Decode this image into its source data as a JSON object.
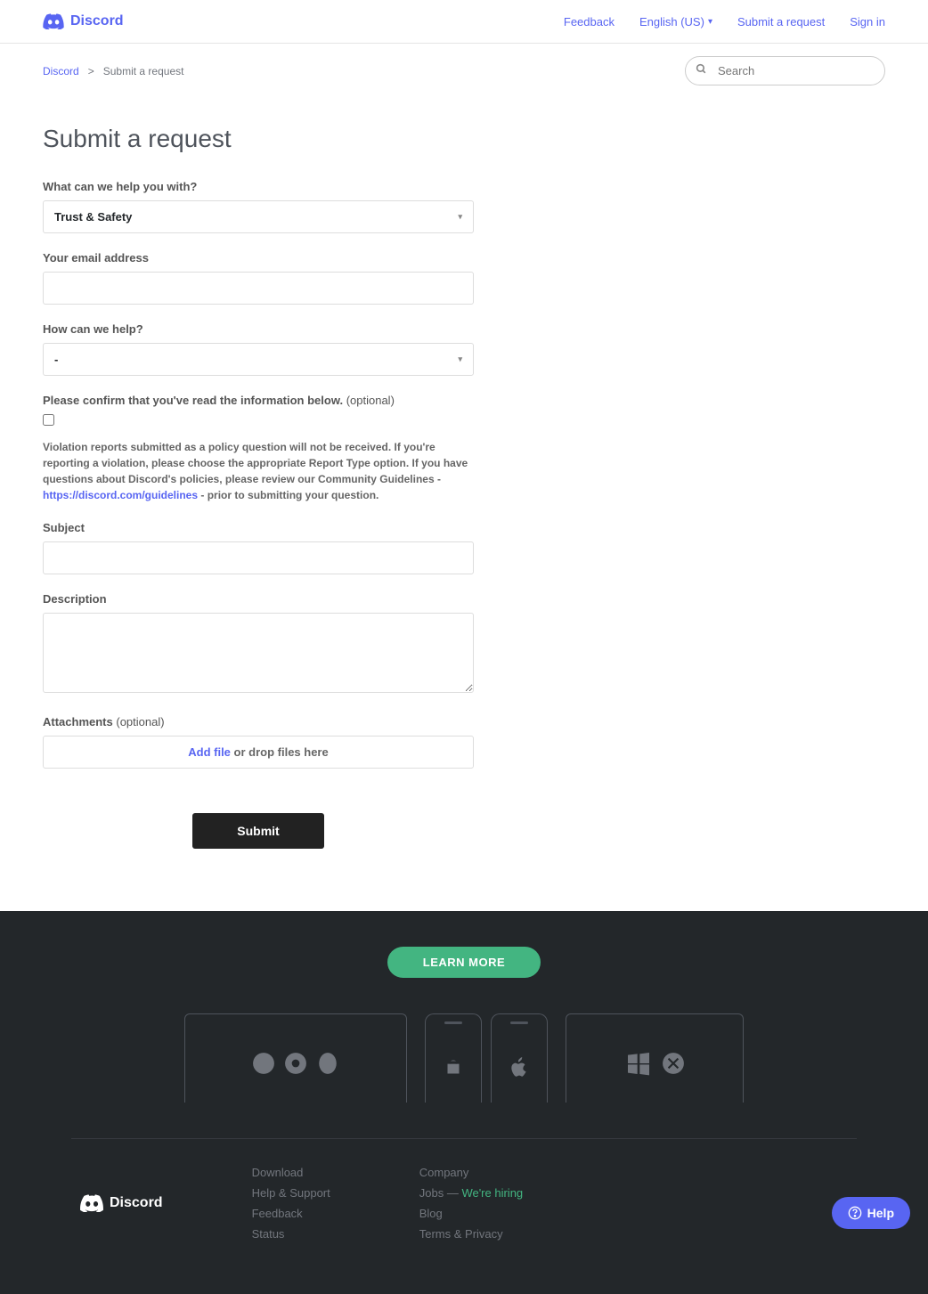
{
  "header": {
    "brand": "Discord",
    "nav": {
      "feedback": "Feedback",
      "language": "English (US)",
      "submit": "Submit a request",
      "signin": "Sign in"
    }
  },
  "breadcrumb": {
    "root": "Discord",
    "sep": ">",
    "current": "Submit a request"
  },
  "search": {
    "placeholder": "Search"
  },
  "page": {
    "title": "Submit a request"
  },
  "form": {
    "help_with": {
      "label": "What can we help you with?",
      "value": "Trust & Safety"
    },
    "email": {
      "label": "Your email address"
    },
    "how_help": {
      "label": "How can we help?",
      "value": "-"
    },
    "confirm": {
      "label": "Please confirm that you've read the information below.",
      "optional": "(optional)",
      "info_pre": "Violation reports submitted as a policy question will not be received. If you're reporting a violation, please choose the appropriate Report Type option. If you have questions about Discord's policies, please review our Community Guidelines - ",
      "info_link": "https://discord.com/guidelines",
      "info_post": " - prior to submitting your question."
    },
    "subject": {
      "label": "Subject"
    },
    "description": {
      "label": "Description"
    },
    "attachments": {
      "label": "Attachments",
      "optional": "(optional)",
      "add_file": "Add file",
      "or_drop": " or drop files here"
    },
    "submit": "Submit"
  },
  "footer": {
    "learn_more": "LEARN MORE",
    "brand": "Discord",
    "col1": {
      "download": "Download",
      "help": "Help & Support",
      "feedback": "Feedback",
      "status": "Status"
    },
    "col2": {
      "company": "Company",
      "jobs": "Jobs — ",
      "hiring": "We're hiring",
      "blog": "Blog",
      "terms": "Terms & Privacy"
    }
  },
  "help_widget": {
    "label": "Help"
  }
}
